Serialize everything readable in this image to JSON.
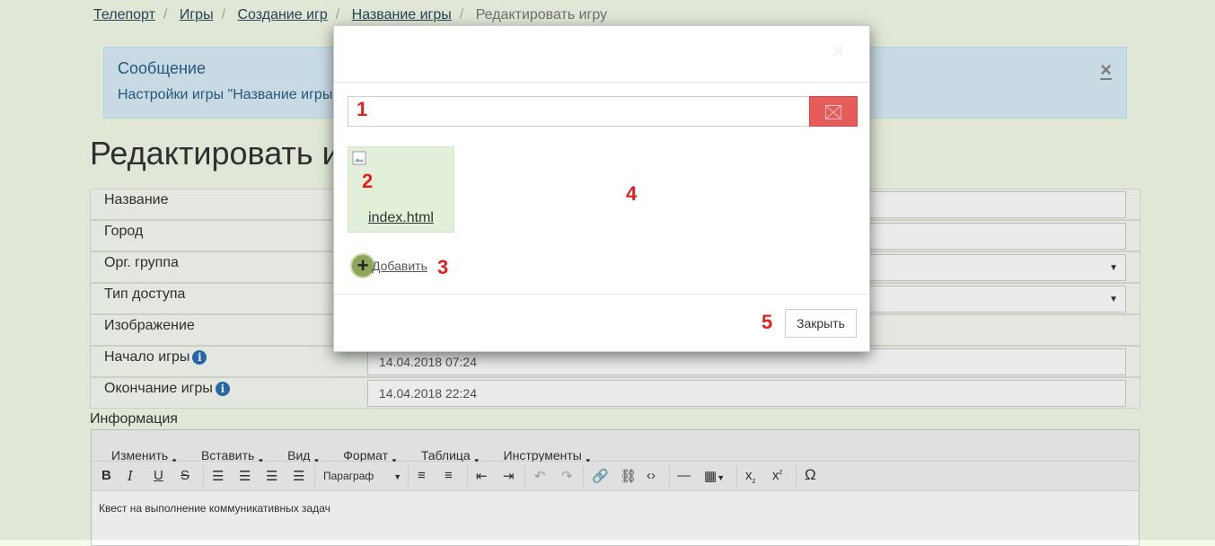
{
  "breadcrumb": [
    "Телепорт",
    "Игры",
    "Создание игр",
    "Название игры",
    "Редактировать игру"
  ],
  "alert": {
    "title": "Сообщение",
    "message": "Настройки игры \"Название игры",
    "close": "×"
  },
  "page_title": "Редактировать и",
  "form": {
    "name_label": "Название",
    "city_label": "Город",
    "org_label": "Орг. группа",
    "access_label": "Тип доступа",
    "image_label": "Изображение",
    "start_label": "Начало игры",
    "start_value": "14.04.2018 07:24",
    "end_label": "Окончание игры",
    "end_value": "14.04.2018 22:24",
    "info_label": "Информация"
  },
  "editor": {
    "menus": [
      "Изменить",
      "Вставить",
      "Вид",
      "Формат",
      "Таблица",
      "Инструменты"
    ],
    "paragraph": "Параграф",
    "content": "Квест на выполнение коммуникативных задач"
  },
  "modal": {
    "file_name": "index.html",
    "add_label": "Добавить",
    "close_label": "Закрыть"
  },
  "markers": [
    "1",
    "2",
    "3",
    "4",
    "5"
  ]
}
